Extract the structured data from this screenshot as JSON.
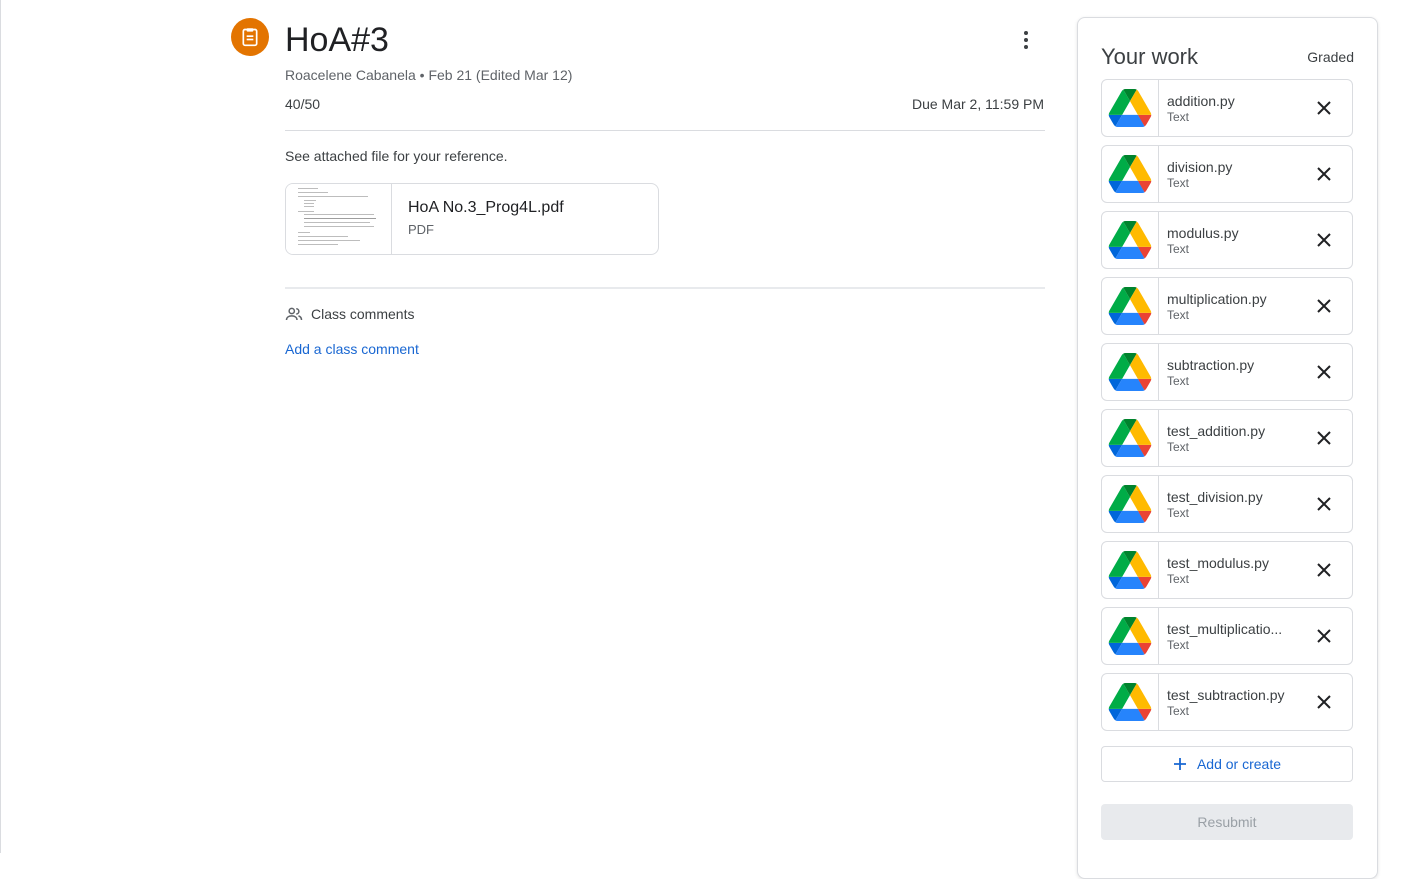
{
  "assignment": {
    "title": "HoA#3",
    "meta": "Roacelene Cabanela • Feb 21 (Edited Mar 12)",
    "points": "40/50",
    "due": "Due Mar 2, 11:59 PM",
    "instructions": "See attached file for your reference.",
    "attachment": {
      "title": "HoA No.3_Prog4L.pdf",
      "type": "PDF"
    },
    "icon": "assignment-icon",
    "accent_color": "#e37400"
  },
  "comments": {
    "header": "Class comments",
    "add_link": "Add a class comment"
  },
  "work": {
    "title": "Your work",
    "status": "Graded",
    "files": [
      {
        "name": "addition.py",
        "kind": "Text"
      },
      {
        "name": "division.py",
        "kind": "Text"
      },
      {
        "name": "modulus.py",
        "kind": "Text"
      },
      {
        "name": "multiplication.py",
        "kind": "Text"
      },
      {
        "name": "subtraction.py",
        "kind": "Text"
      },
      {
        "name": "test_addition.py",
        "kind": "Text"
      },
      {
        "name": "test_division.py",
        "kind": "Text"
      },
      {
        "name": "test_modulus.py",
        "kind": "Text"
      },
      {
        "name": "test_multiplicatio...",
        "kind": "Text"
      },
      {
        "name": "test_subtraction.py",
        "kind": "Text"
      }
    ],
    "add_label": "Add or create",
    "resubmit_label": "Resubmit",
    "link_color": "#1967d2"
  }
}
